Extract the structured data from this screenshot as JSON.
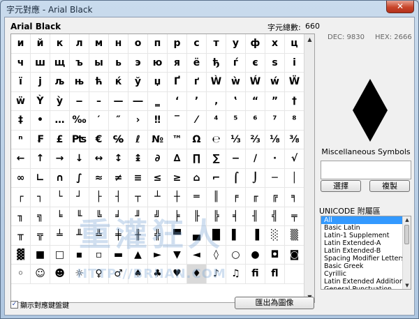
{
  "window": {
    "title": "字元對應 - Arial Black",
    "close_label": "✕"
  },
  "header": {
    "font_name": "Arial Black",
    "count_label": "字元總數:",
    "count_value": "660"
  },
  "grid": {
    "rows": [
      [
        "и",
        "й",
        "к",
        "л",
        "м",
        "н",
        "о",
        "п",
        "р",
        "с",
        "т",
        "у",
        "ф",
        "х",
        "ц"
      ],
      [
        "ч",
        "ш",
        "щ",
        "ъ",
        "ы",
        "ь",
        "э",
        "ю",
        "я",
        "ё",
        "ђ",
        "ѓ",
        "є",
        "ѕ",
        "і"
      ],
      [
        "ї",
        "ј",
        "љ",
        "њ",
        "ћ",
        "ќ",
        "ў",
        "џ",
        "Ґ",
        "ґ",
        "Ẁ",
        "ẁ",
        "Ẃ",
        "ẃ",
        "Ẅ"
      ],
      [
        "ẅ",
        "Ỳ",
        "ỳ",
        "‒",
        "–",
        "—",
        "―",
        "‗",
        "‘",
        "’",
        "‚",
        "‛",
        "“",
        "”",
        "†"
      ],
      [
        "‡",
        "•",
        "…",
        "‰",
        "′",
        "″",
        "›",
        "‼",
        "‾",
        "⁄",
        "⁴",
        "⁵",
        "⁶",
        "⁷",
        "⁸"
      ],
      [
        "ⁿ",
        "₣",
        "£",
        "₧",
        "€",
        "℅",
        "ℓ",
        "№",
        "™",
        "Ω",
        "℮",
        "⅓",
        "⅔",
        "⅛",
        "⅜"
      ],
      [
        "←",
        "↑",
        "→",
        "↓",
        "↔",
        "↕",
        "↨",
        "∂",
        "∆",
        "∏",
        "∑",
        "−",
        "∕",
        "∙",
        "√"
      ],
      [
        "∞",
        "∟",
        "∩",
        "∫",
        "≈",
        "≠",
        "≡",
        "≤",
        "≥",
        "⌂",
        "⌐",
        "⌠",
        "⌡",
        "─",
        "│"
      ],
      [
        "┌",
        "┐",
        "└",
        "┘",
        "├",
        "┤",
        "┬",
        "┴",
        "┼",
        "═",
        "║",
        "╒",
        "╓",
        "╔",
        "╕"
      ],
      [
        "╖",
        "╗",
        "╘",
        "╙",
        "╚",
        "╛",
        "╜",
        "╝",
        "╞",
        "╟",
        "╠",
        "╡",
        "╢",
        "╣",
        "╤"
      ],
      [
        "╥",
        "╦",
        "╧",
        "╨",
        "╩",
        "╪",
        "╫",
        "╬",
        "▀",
        "▄",
        "█",
        "▌",
        "▐",
        "░",
        "▒"
      ],
      [
        "▓",
        "■",
        "□",
        "▪",
        "▫",
        "▬",
        "▲",
        "►",
        "▼",
        "◄",
        "◊",
        "○",
        "●",
        "◘",
        "◙"
      ],
      [
        "◦",
        "☺",
        "☻",
        "☼",
        "♀",
        "♂",
        "♠",
        "♣",
        "♥",
        "♦",
        "♪",
        "♫",
        "ﬁ",
        "ﬂ",
        ""
      ]
    ],
    "selected_char": "♦",
    "scroll_up": "▲",
    "scroll_down": "▼"
  },
  "side": {
    "dec_label": "DEC: 9830",
    "hex_label": "HEX: 2666",
    "preview_char": "♦",
    "block_name": "Miscellaneous Symbols",
    "char_box_value": "",
    "select_button": "選擇",
    "copy_button": "複製",
    "unicode_block_label": "UNICODE 附屬區",
    "unicode_blocks": [
      "All",
      "Basic Latin",
      "Latin-1 Supplement",
      "Latin Extended-A",
      "Latin Extended-B",
      "Spacing Modifier Letters",
      "Basic Greek",
      "Cyrillic",
      "Latin Extended Additional",
      "General Punctuation"
    ],
    "selected_block": "All"
  },
  "footer": {
    "checkbox_label": "顯示對應鍵盤鍵",
    "checkbox_checked": true,
    "export_button": "匯出為圖像"
  },
  "watermark": {
    "cn_text": "重灌狂人",
    "url_text": "HTTP://BRIIAN.COM"
  },
  "colors": {
    "accent": "#3399ff",
    "watermark": "#7aa6d6"
  }
}
